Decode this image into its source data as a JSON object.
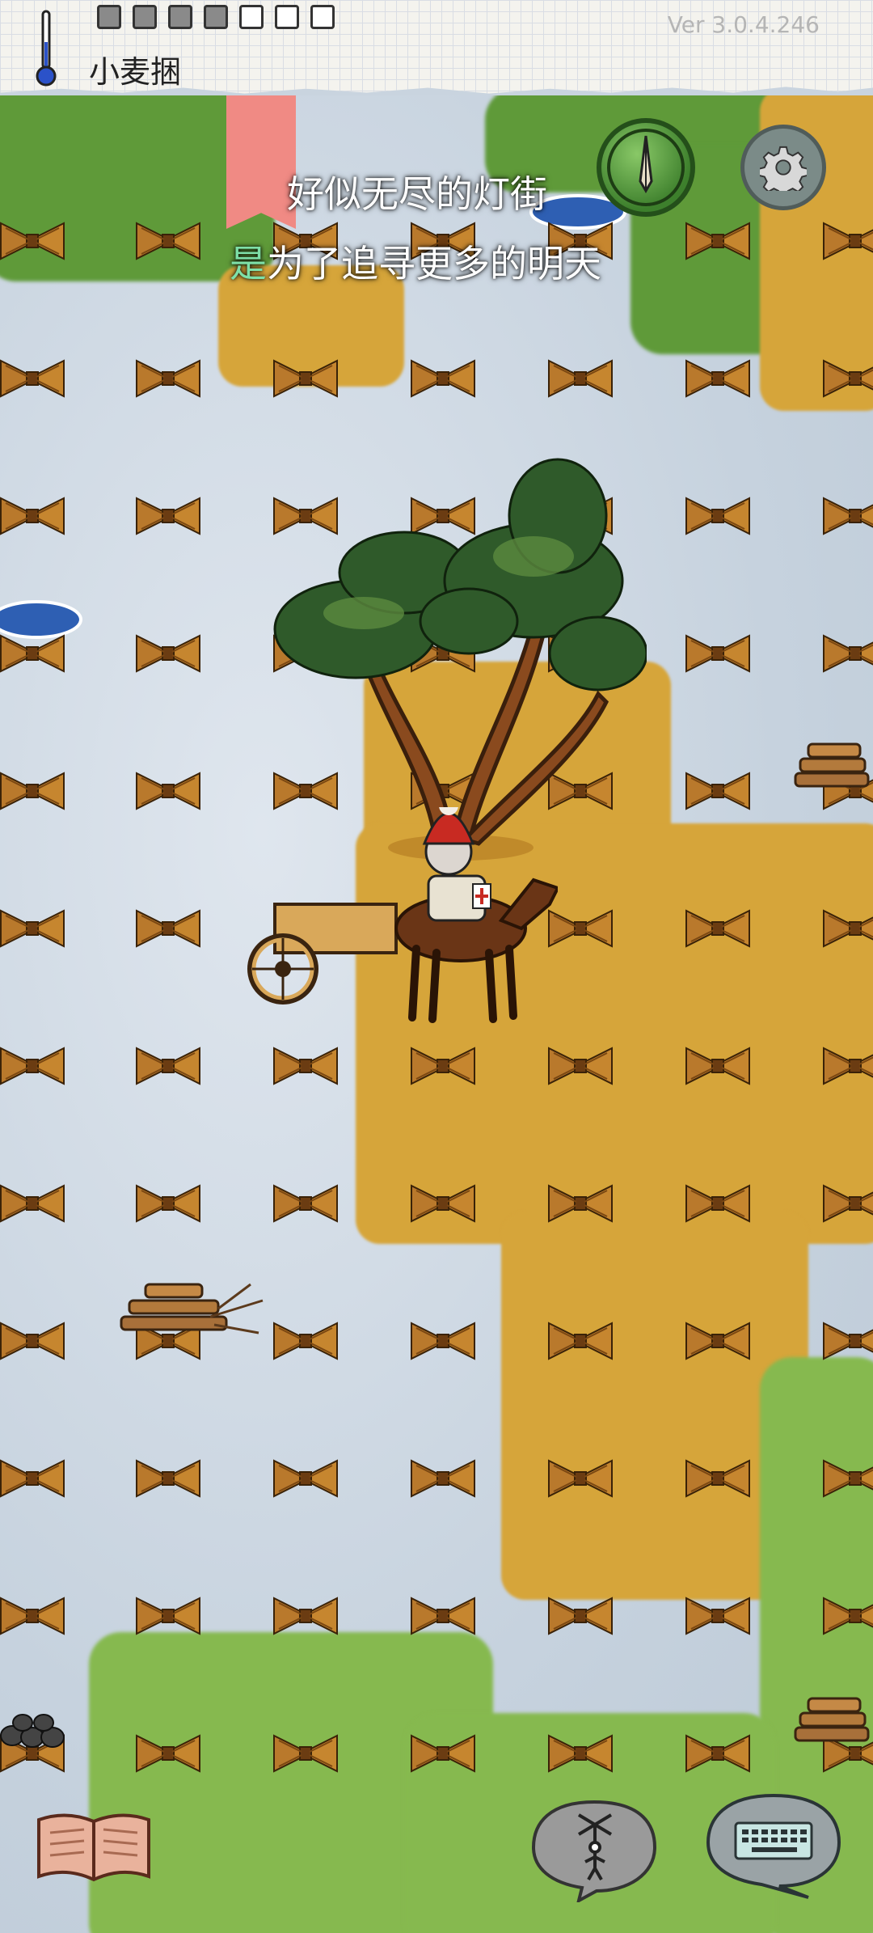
{
  "header": {
    "selected_item": "小麦捆",
    "version": "Ver 3.0.4.246",
    "thermometer_icon": "thermometer-icon",
    "slots_filled": 4,
    "slots_total": 7
  },
  "lyrics": {
    "line1": "好似无尽的灯街",
    "line2_highlight": "是",
    "line2_rest": "为了追寻更多的明天"
  },
  "buttons": {
    "compass": "compass-icon",
    "settings": "gear-icon",
    "journal": "open-book-icon",
    "puppet": "puppet-icon",
    "keyboard": "keyboard-icon"
  },
  "colors": {
    "snow": "#c9d4df",
    "straw": "#d6a53a",
    "grass": "#5f9a39",
    "bookmark": "#f08a84",
    "lyric_highlight": "#7ee0a8"
  }
}
